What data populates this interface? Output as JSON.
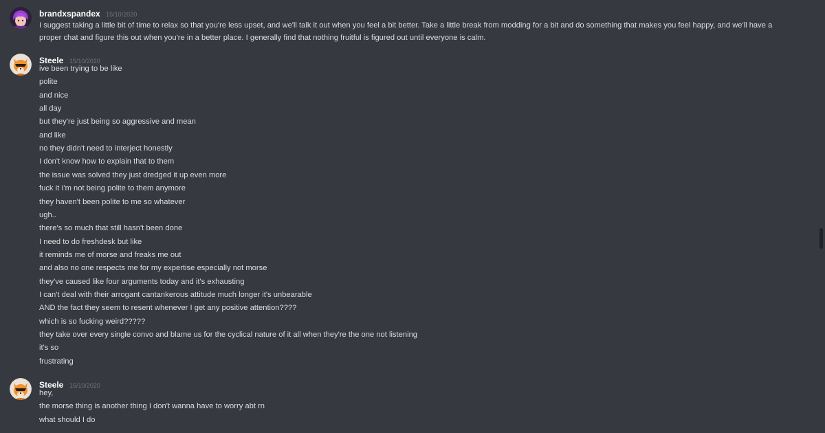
{
  "messages": [
    {
      "author": "brandxspandex",
      "avatar_icon": "purple-haired-character-avatar",
      "timestamp": "15/10/2020",
      "text": "I suggest taking a little bit of time to relax so that you're less upset, and we'll talk it out when you feel a bit better. Take a little break from modding for a bit and do something that makes you feel happy, and we'll have a proper chat and figure this out when you're in a better place. I generally find that nothing fruitful is figured out until everyone is calm."
    },
    {
      "author": "Steele",
      "avatar_icon": "orange-fox-character-avatar",
      "timestamp": "15/10/2020",
      "lines": [
        "ive been trying to be like",
        "polite",
        "and nice",
        "all day",
        "but they're just being so aggressive and mean",
        "and like",
        "no they didn't need to interject honestly",
        "I don't know how to explain that to them",
        "the issue was solved they just dredged it up even more",
        "fuck it I'm not being polite to them anymore",
        "they haven't been polite to me so whatever",
        "ugh..",
        "there's so much that still hasn't been done",
        "I need to do freshdesk but like",
        "it reminds me of morse and freaks me out",
        "and also no one respects me for my expertise especially not morse",
        "they've caused like four arguments today and it's exhausting",
        "I can't deal with their arrogant cantankerous attitude much longer it's unbearable",
        "AND the fact they seem to resent whenever I get any positive attention????",
        "which is so fucking weird?????",
        "they take over every single convo and blame us for the cyclical nature of it all when they're the one not listening",
        "it's so",
        "frustrating"
      ]
    },
    {
      "author": "Steele",
      "avatar_icon": "orange-fox-character-avatar",
      "timestamp": "15/10/2020",
      "lines": [
        "hey,",
        "the morse thing is another thing I don't wanna have to worry abt rn",
        "what should I do"
      ]
    }
  ],
  "colors": {
    "background": "#36393f",
    "username": "#ffffff",
    "message_text": "#dcddde",
    "timestamp": "#72767d",
    "scrollbar_thumb": "#202225"
  }
}
